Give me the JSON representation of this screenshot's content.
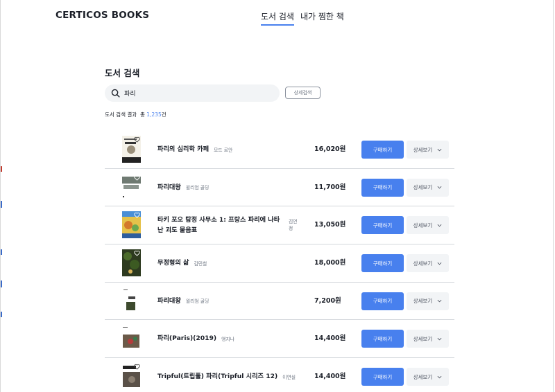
{
  "header": {
    "brand": "CERTICOS BOOKS",
    "tabs": [
      {
        "label": "도서 검색",
        "active": true
      },
      {
        "label": "내가 찜한 책",
        "active": false
      }
    ]
  },
  "search": {
    "title": "도서 검색",
    "query": "파리",
    "detail_button": "상세검색",
    "result_label": "도서 검색 결과",
    "total_prefix": "총",
    "total_count": "1,235",
    "total_suffix": "건"
  },
  "buy_label": "구매하기",
  "detail_label": "상세보기",
  "colors": {
    "accent": "#4880ee",
    "row_divider": "#d2d6da",
    "secondary_bg": "#f2f4f6"
  },
  "books": [
    {
      "title": "파리의 심리학 카페",
      "author": "모드 르안",
      "price": "16,020원"
    },
    {
      "title": "파리대왕",
      "author": "윌리엄 골딩",
      "price": "11,700원"
    },
    {
      "title": "타키 포오 탐정 사무소 1: 프랑스 파리에 나타난 괴도 물음표",
      "author": "김언정",
      "price": "13,050원"
    },
    {
      "title": "무정형의 삶",
      "author": "김민철",
      "price": "18,000원"
    },
    {
      "title": "파리대왕",
      "author": "윌리엄 골딩",
      "price": "7,200원"
    },
    {
      "title": "파리(Paris)(2019)",
      "author": "앵지나",
      "price": "14,400원"
    },
    {
      "title": "Tripful(트립풀) 파리(Tripful 시리즈 12)",
      "author": "이연실",
      "price": "14,400원"
    }
  ]
}
